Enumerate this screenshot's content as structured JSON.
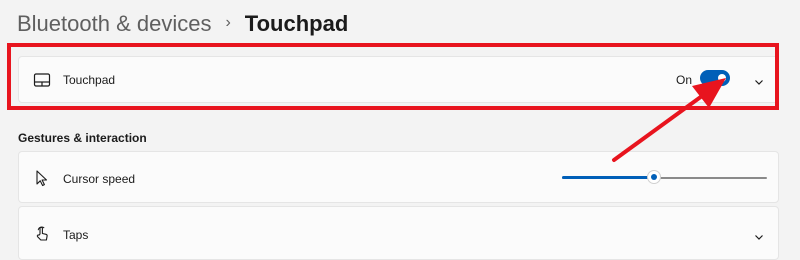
{
  "breadcrumb": {
    "parent": "Bluetooth & devices",
    "separator": "›",
    "current": "Touchpad"
  },
  "touchpad": {
    "label": "Touchpad",
    "state_text": "On",
    "toggle_on": true,
    "icon": "touchpad-icon"
  },
  "gestures": {
    "section_title": "Gestures & interaction",
    "cursor_speed": {
      "label": "Cursor speed",
      "icon": "cursor-icon",
      "slider_fraction": 0.45
    },
    "taps": {
      "label": "Taps",
      "icon": "tap-hand-icon"
    }
  },
  "colors": {
    "accent": "#005fb8",
    "annotation_red": "#e8141e",
    "background": "#f3f3f3",
    "card": "#fbfbfb"
  }
}
